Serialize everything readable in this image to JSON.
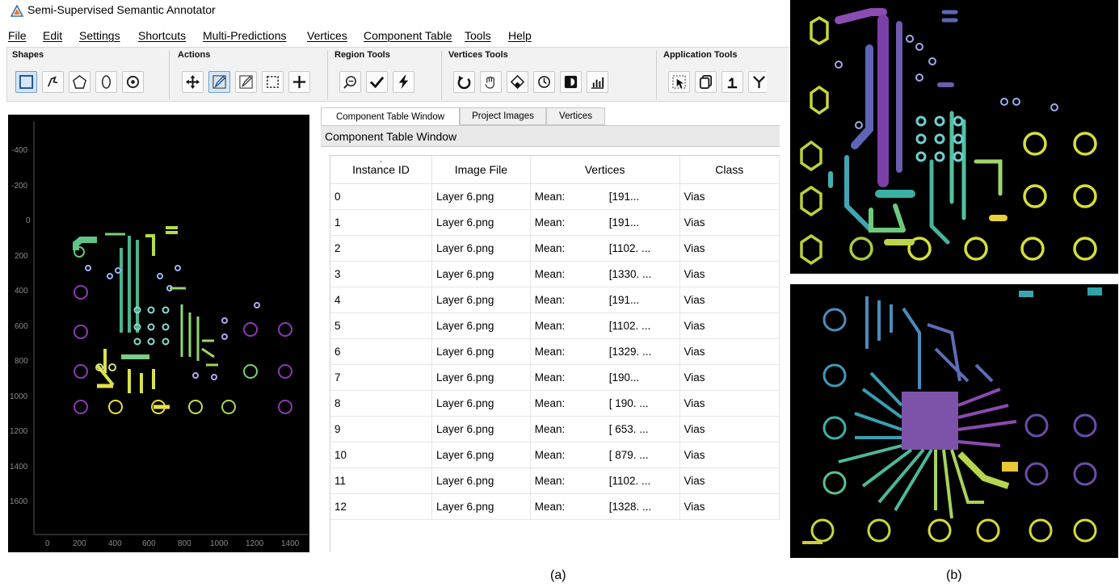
{
  "window": {
    "title": "Semi-Supervised Semantic Annotator"
  },
  "menu": [
    "File",
    "Edit",
    "Settings",
    "Shortcuts",
    "Multi-Predictions",
    "Vertices",
    "Component Table",
    "Tools",
    "Help"
  ],
  "toolbar": {
    "groups": [
      {
        "label": "Shapes",
        "buttons": [
          "rectangle-icon",
          "freehand-icon",
          "polygon-icon",
          "ellipse-icon",
          "point-icon"
        ]
      },
      {
        "label": "Actions",
        "buttons": [
          "move-icon",
          "edit-shape-icon",
          "erase-shape-icon",
          "select-region-icon",
          "crosshair-icon"
        ]
      },
      {
        "label": "Region Tools",
        "buttons": [
          "zoom-icon",
          "confirm-icon",
          "quick-predict-icon"
        ]
      },
      {
        "label": "Vertices Tools",
        "buttons": [
          "undo-icon",
          "hand-icon",
          "eraser-icon",
          "history-icon",
          "contrast-icon",
          "stats-icon"
        ]
      },
      {
        "label": "Application Tools",
        "buttons": [
          "select-pointer-icon",
          "copy-icon",
          "merge-icon",
          "split-icon"
        ]
      }
    ]
  },
  "canvas": {
    "y_ticks": [
      "-400",
      "-200",
      "0",
      "200",
      "400",
      "600",
      "800",
      "1000",
      "1200",
      "1400",
      "1600"
    ],
    "x_ticks": [
      "0",
      "200",
      "400",
      "600",
      "800",
      "1000",
      "1200",
      "1400"
    ]
  },
  "tabs": [
    "Component Table Window",
    "Project Images",
    "Vertices"
  ],
  "panel_title": "Component Table Window",
  "table": {
    "columns": [
      "Instance ID",
      "Image File",
      "Vertices",
      "Class"
    ],
    "rows": [
      {
        "id": "0",
        "file": "Layer 6.png",
        "mean": "Mean:",
        "vert": "[191...",
        "cls": "Vias"
      },
      {
        "id": "1",
        "file": "Layer 6.png",
        "mean": "Mean:",
        "vert": "[191...",
        "cls": "Vias"
      },
      {
        "id": "2",
        "file": "Layer 6.png",
        "mean": "Mean:",
        "vert": "[1102.  ...",
        "cls": "Vias"
      },
      {
        "id": "3",
        "file": "Layer 6.png",
        "mean": "Mean:",
        "vert": "[1330.  ...",
        "cls": "Vias"
      },
      {
        "id": "4",
        "file": "Layer 6.png",
        "mean": "Mean:",
        "vert": "[191...",
        "cls": "Vias"
      },
      {
        "id": "5",
        "file": "Layer 6.png",
        "mean": "Mean:",
        "vert": "[1102.  ...",
        "cls": "Vias"
      },
      {
        "id": "6",
        "file": "Layer 6.png",
        "mean": "Mean:",
        "vert": "[1329.  ...",
        "cls": "Vias"
      },
      {
        "id": "7",
        "file": "Layer 6.png",
        "mean": "Mean:",
        "vert": "[190...",
        "cls": "Vias"
      },
      {
        "id": "8",
        "file": "Layer 6.png",
        "mean": "Mean:",
        "vert": "[ 190.  ...",
        "cls": "Vias"
      },
      {
        "id": "9",
        "file": "Layer 6.png",
        "mean": "Mean:",
        "vert": "[ 653.  ...",
        "cls": "Vias"
      },
      {
        "id": "10",
        "file": "Layer 6.png",
        "mean": "Mean:",
        "vert": "[ 879.  ...",
        "cls": "Vias"
      },
      {
        "id": "11",
        "file": "Layer 6.png",
        "mean": "Mean:",
        "vert": "[1102.  ...",
        "cls": "Vias"
      },
      {
        "id": "12",
        "file": "Layer 6.png",
        "mean": "Mean:",
        "vert": "[1328.  ...",
        "cls": "Vias"
      }
    ]
  },
  "captions": {
    "a": "(a)",
    "b": "(b)"
  }
}
